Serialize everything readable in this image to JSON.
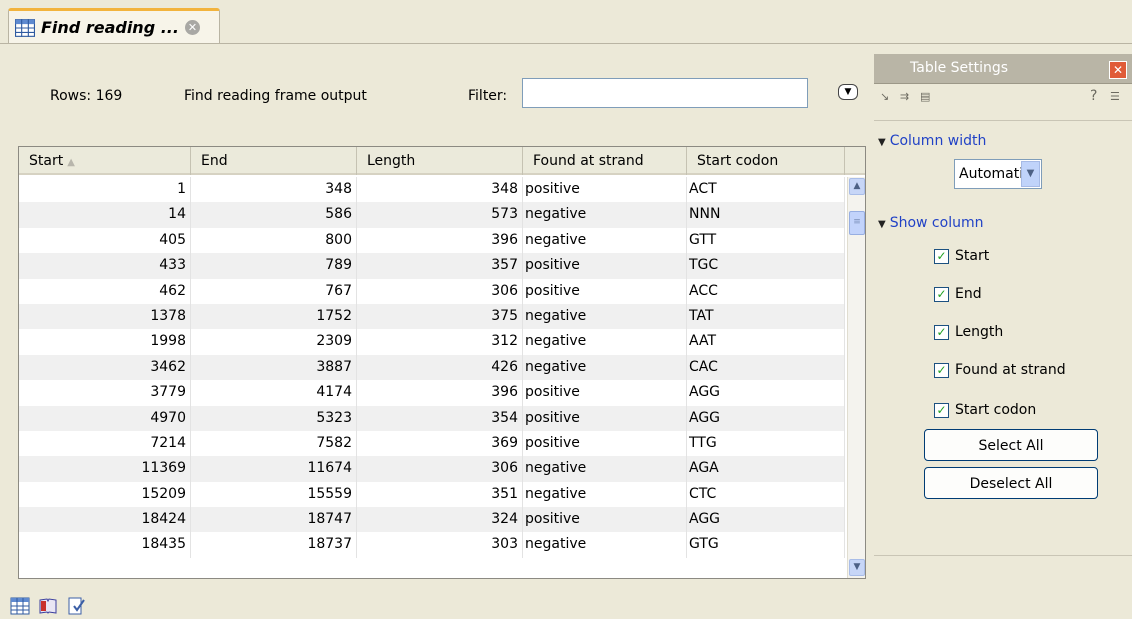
{
  "tab": {
    "title": "Find reading ...",
    "close_icon": "close-icon",
    "table_icon": "table-icon"
  },
  "toolbar": {
    "rows_label": "Rows: 169",
    "output_label": "Find reading frame output",
    "filter_label": "Filter:",
    "filter_value": "",
    "menu_icon": "dropdown-menu-icon"
  },
  "table": {
    "columns": [
      {
        "label": "Start",
        "sorted": "ascending"
      },
      {
        "label": "End"
      },
      {
        "label": "Length"
      },
      {
        "label": "Found at strand"
      },
      {
        "label": "Start codon"
      }
    ],
    "rows": [
      [
        "1",
        "348",
        "348",
        "positive",
        "ACT"
      ],
      [
        "14",
        "586",
        "573",
        "negative",
        "NNN"
      ],
      [
        "405",
        "800",
        "396",
        "negative",
        "GTT"
      ],
      [
        "433",
        "789",
        "357",
        "positive",
        "TGC"
      ],
      [
        "462",
        "767",
        "306",
        "positive",
        "ACC"
      ],
      [
        "1378",
        "1752",
        "375",
        "negative",
        "TAT"
      ],
      [
        "1998",
        "2309",
        "312",
        "negative",
        "AAT"
      ],
      [
        "3462",
        "3887",
        "426",
        "negative",
        "CAC"
      ],
      [
        "3779",
        "4174",
        "396",
        "positive",
        "AGG"
      ],
      [
        "4970",
        "5323",
        "354",
        "positive",
        "AGG"
      ],
      [
        "7214",
        "7582",
        "369",
        "positive",
        "TTG"
      ],
      [
        "11369",
        "11674",
        "306",
        "negative",
        "AGA"
      ],
      [
        "15209",
        "15559",
        "351",
        "negative",
        "CTC"
      ],
      [
        "18424",
        "18747",
        "324",
        "positive",
        "AGG"
      ],
      [
        "18435",
        "18737",
        "303",
        "negative",
        "GTG"
      ]
    ]
  },
  "bottom_icons": [
    "table-view-icon",
    "book-icon",
    "history-icon"
  ],
  "side_panel": {
    "title": "Table Settings",
    "help_label": "?",
    "column_width": {
      "label": "Column width",
      "value": "Automatic"
    },
    "show_column": {
      "label": "Show column",
      "items": [
        {
          "label": "Start",
          "checked": true
        },
        {
          "label": "End",
          "checked": true
        },
        {
          "label": "Length",
          "checked": true
        },
        {
          "label": "Found at strand",
          "checked": true
        },
        {
          "label": "Start codon",
          "checked": true
        }
      ]
    },
    "select_all_label": "Select All",
    "deselect_all_label": "Deselect All"
  },
  "colors": {
    "accent_tab": "#f2b33d",
    "link_blue": "#2142c6",
    "panel_bg": "#ece9d8",
    "close_red": "#e05b38"
  }
}
